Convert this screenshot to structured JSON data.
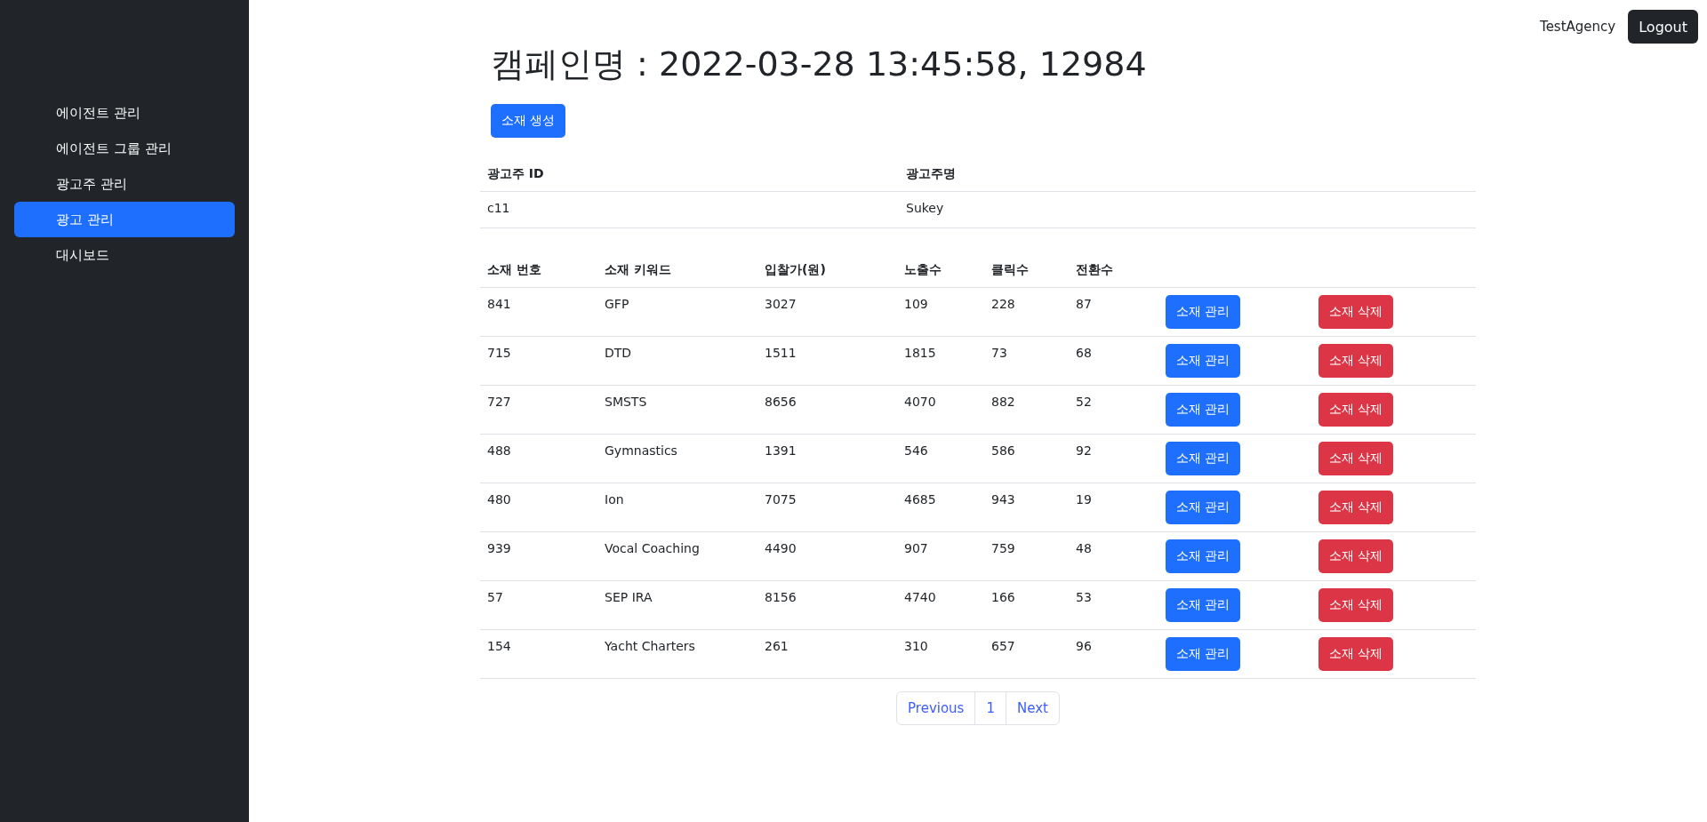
{
  "sidebar": {
    "items": [
      {
        "label": "에이전트 관리",
        "selected": false
      },
      {
        "label": "에이전트 그룹 관리",
        "selected": false
      },
      {
        "label": "광고주 관리",
        "selected": false
      },
      {
        "label": "광고 관리",
        "selected": true
      },
      {
        "label": "대시보드",
        "selected": false
      }
    ]
  },
  "header": {
    "user": "TestAgency",
    "logout": "Logout"
  },
  "title": "캠페인명 : 2022-03-28 13:45:58, 12984",
  "create_button": "소재 생성",
  "advertiser_table": {
    "columns": [
      "광고주 ID",
      "광고주명"
    ],
    "rows": [
      [
        "c11",
        "Sukey"
      ]
    ]
  },
  "creative_table": {
    "columns": [
      "소재 번호",
      "소재 키워드",
      "입찰가(원)",
      "노출수",
      "클릭수",
      "전환수"
    ],
    "rows": [
      {
        "cells": [
          "841",
          "GFP",
          "3027",
          "109",
          "228",
          "87"
        ],
        "manage": "소재 관리",
        "delete": "소재 삭제"
      },
      {
        "cells": [
          "715",
          "DTD",
          "1511",
          "1815",
          "73",
          "68"
        ],
        "manage": "소재 관리",
        "delete": "소재 삭제"
      },
      {
        "cells": [
          "727",
          "SMSTS",
          "8656",
          "4070",
          "882",
          "52"
        ],
        "manage": "소재 관리",
        "delete": "소재 삭제"
      },
      {
        "cells": [
          "488",
          "Gymnastics",
          "1391",
          "546",
          "586",
          "92"
        ],
        "manage": "소재 관리",
        "delete": "소재 삭제"
      },
      {
        "cells": [
          "480",
          "Ion",
          "7075",
          "4685",
          "943",
          "19"
        ],
        "manage": "소재 관리",
        "delete": "소재 삭제"
      },
      {
        "cells": [
          "939",
          "Vocal Coaching",
          "4490",
          "907",
          "759",
          "48"
        ],
        "manage": "소재 관리",
        "delete": "소재 삭제"
      },
      {
        "cells": [
          "57",
          "SEP IRA",
          "8156",
          "4740",
          "166",
          "53"
        ],
        "manage": "소재 관리",
        "delete": "소재 삭제"
      },
      {
        "cells": [
          "154",
          "Yacht Charters",
          "261",
          "310",
          "657",
          "96"
        ],
        "manage": "소재 관리",
        "delete": "소재 삭제"
      }
    ]
  },
  "pagination": [
    "Previous",
    "1",
    "Next"
  ]
}
